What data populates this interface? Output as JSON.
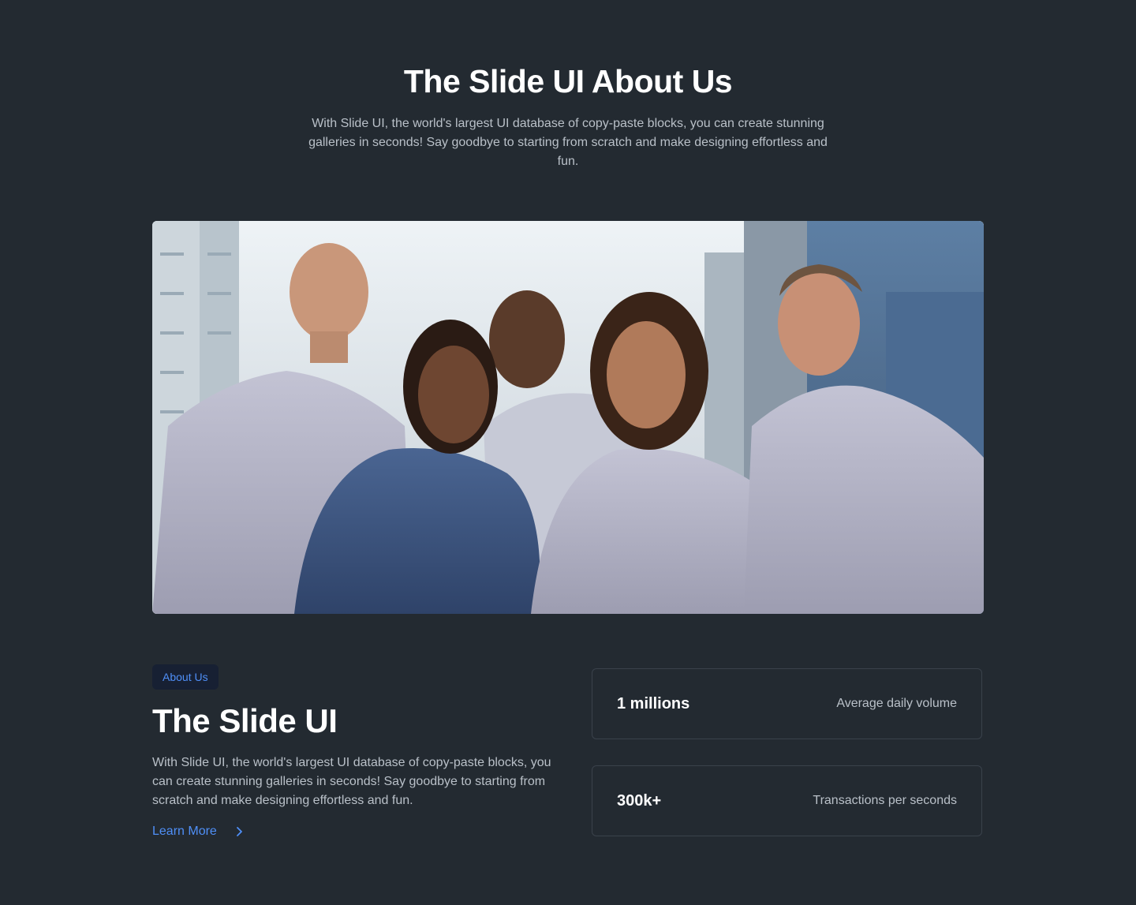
{
  "hero": {
    "title": "The Slide UI About Us",
    "description": "With Slide UI, the world's largest UI database of copy-paste blocks, you can create stunning galleries in seconds! Say goodbye to starting from scratch and make designing effortless and fun."
  },
  "photo": {
    "subject": "team-photo"
  },
  "about": {
    "badge": "About Us",
    "title": "The Slide UI",
    "description": "With Slide UI, the world's largest UI database of copy-paste blocks, you can create stunning galleries in seconds! Say goodbye to starting from scratch and make designing effortless and fun.",
    "link_label": "Learn More",
    "link_icon": "chevron-right-icon"
  },
  "stats": [
    {
      "value": "1 millions",
      "label": "Average daily volume"
    },
    {
      "value": "300k+",
      "label": "Transactions per seconds"
    }
  ],
  "colors": {
    "background": "#232a31",
    "accent": "#4f8ff7",
    "badge_background": "#172033",
    "muted_text": "#b9c0c8",
    "card_border": "#3a424b"
  }
}
